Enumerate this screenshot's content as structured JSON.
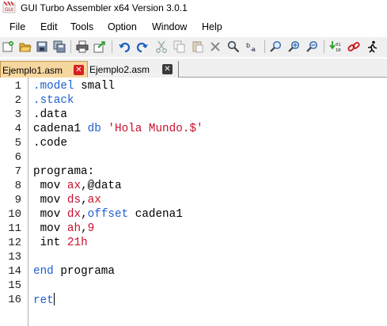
{
  "window": {
    "title": "GUI Turbo Assembler x64 Version 3.0.1",
    "icon": "gui-turbo-assembler-app-icon"
  },
  "menu": [
    {
      "label": "File"
    },
    {
      "label": "Edit"
    },
    {
      "label": "Tools"
    },
    {
      "label": "Option"
    },
    {
      "label": "Window"
    },
    {
      "label": "Help"
    }
  ],
  "toolbar": {
    "icons": [
      "new-file-icon",
      "open-folder-icon",
      "save-icon",
      "save-all-icon",
      "print-icon",
      "export-icon",
      "undo-icon",
      "redo-icon",
      "cut-icon",
      "copy-icon",
      "paste-icon",
      "delete-icon",
      "find-icon",
      "replace-icon",
      "zoom-icon",
      "zoom-in-icon",
      "zoom-out-icon",
      "compile-icon",
      "link-icon",
      "run-icon"
    ]
  },
  "tabs": [
    {
      "label": "Ejemplo1.asm",
      "active": true
    },
    {
      "label": "Ejemplo2.asm",
      "active": false
    }
  ],
  "editor": {
    "line_numbers": [
      "1",
      "2",
      "3",
      "4",
      "5",
      "6",
      "7",
      "8",
      "9",
      "10",
      "11",
      "12",
      "13",
      "14",
      "15",
      "16"
    ],
    "lines": [
      {
        "s1": ".model",
        "s2": " small"
      },
      {
        "s1": ".stack"
      },
      {
        "s1": ".data"
      },
      {
        "s1": "cadena1 ",
        "s2": "db",
        "s3": " ",
        "s4": "'Hola Mundo.$'"
      },
      {
        "s1": ".code"
      },
      {},
      {
        "s1": "programa:"
      },
      {
        "s1": " mov ",
        "s2": "ax",
        "s3": ",@data"
      },
      {
        "s1": " mov ",
        "s2": "ds",
        "s3": ",",
        "s4": "ax"
      },
      {
        "s1": " mov ",
        "s2": "dx",
        "s3": ",",
        "s4": "offset",
        "s5": " cadena1"
      },
      {
        "s1": " mov ",
        "s2": "ah",
        "s3": ",",
        "s4": "9"
      },
      {
        "s1": " int ",
        "s2": "21h"
      },
      {},
      {
        "s1": "end",
        "s2": " programa"
      },
      {},
      {
        "s1": "ret"
      }
    ]
  },
  "colors": {
    "keyword": "#1f5fd0",
    "register": "#c8102e",
    "string": "#c8102e",
    "active_tab": "#f7d7a0"
  }
}
